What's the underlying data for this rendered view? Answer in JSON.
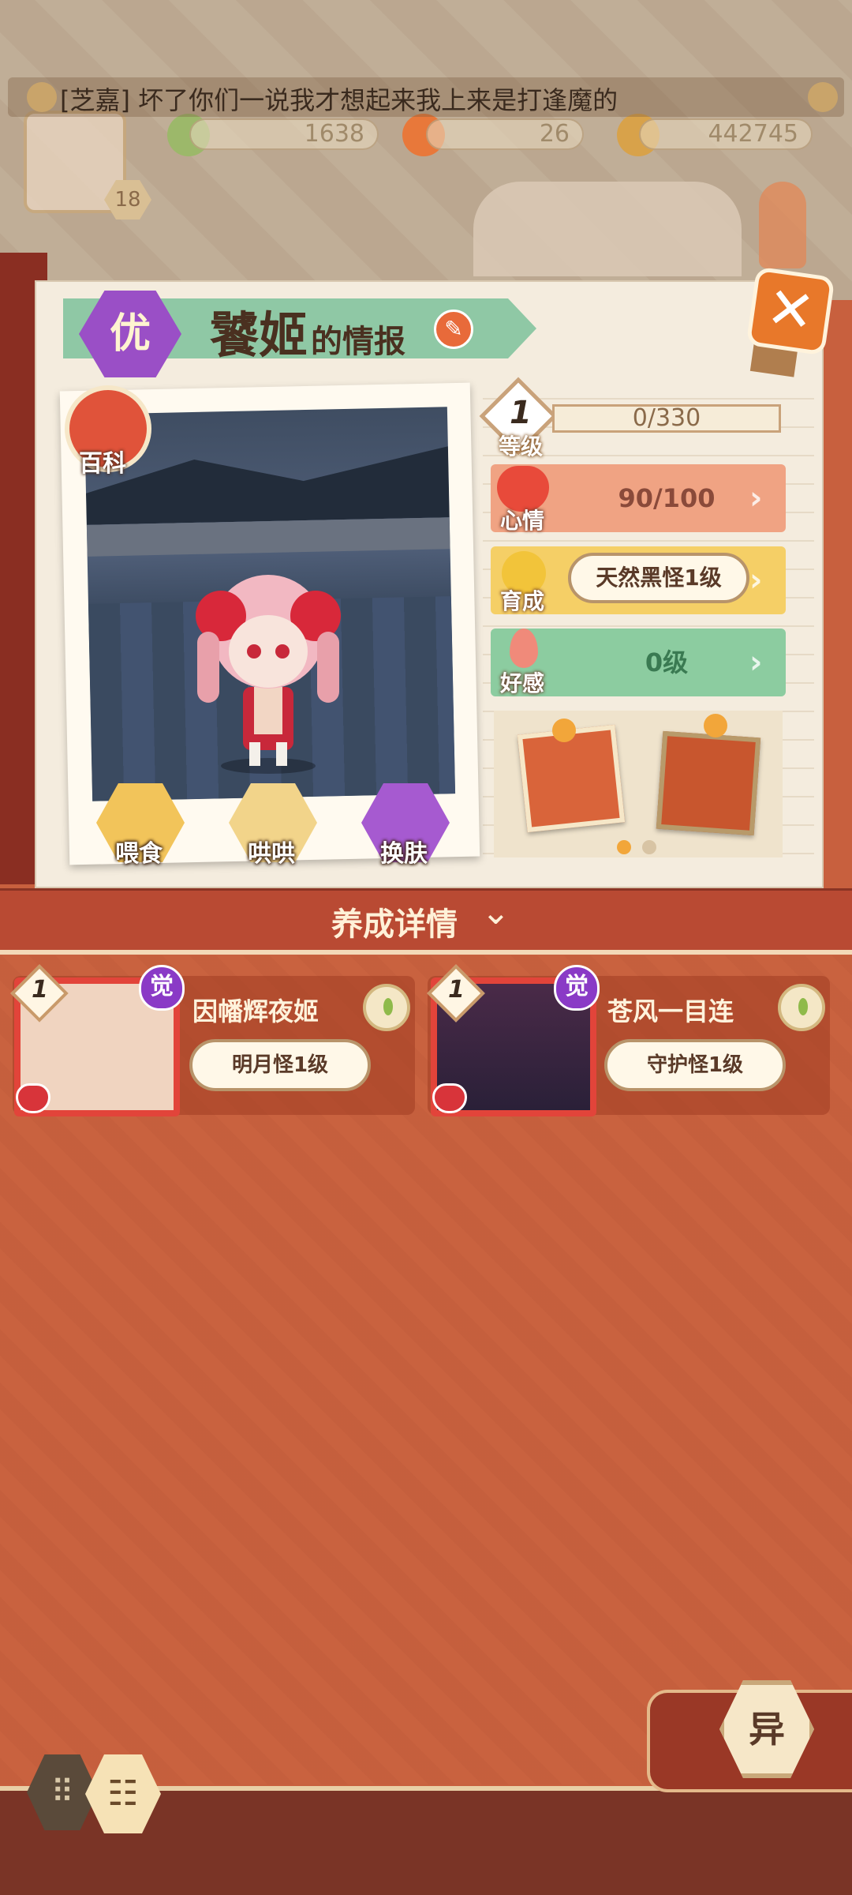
{
  "chat": {
    "sender": "[芝嘉]",
    "message": "坏了你们一说我才想起来我上来是打逢魔的"
  },
  "resources": {
    "jade": "1638",
    "stamina": "26",
    "coins": "442745"
  },
  "player": {
    "level": "18"
  },
  "profile": {
    "rank_badge": "优",
    "name": "饕姬",
    "title_suffix": "的情报",
    "wiki_label": "百科",
    "actions": {
      "feed": "喂食",
      "coax": "哄哄",
      "skin": "换肤"
    }
  },
  "stats": {
    "level": {
      "num": "1",
      "label": "等级",
      "value": "0/330"
    },
    "mood": {
      "label": "心情",
      "value": "90/100"
    },
    "growth": {
      "label": "育成",
      "value": "天然黑怪1级"
    },
    "affection": {
      "label": "好感",
      "value": "0级"
    }
  },
  "detail_title": "养成详情",
  "pets": [
    {
      "level": "1",
      "badge": "觉",
      "name": "因幡辉夜姬",
      "tag": "明月怪1级"
    },
    {
      "level": "1",
      "badge": "觉",
      "name": "苍风一目连",
      "tag": "守护怪1级"
    }
  ],
  "bottom": {
    "special_button": "异"
  },
  "colors": {
    "accent": "#c8603e",
    "ribbon": "#8fc8a5",
    "mood": "#f0a383",
    "growth": "#f5cf66",
    "affection": "#8ccca0",
    "rank_purple": "#9a4fc6"
  }
}
